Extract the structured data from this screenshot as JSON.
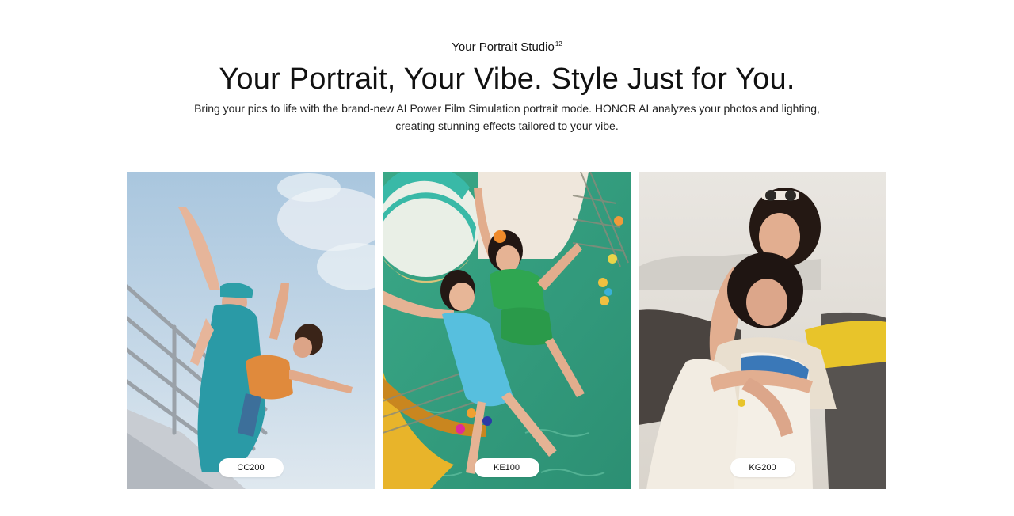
{
  "header": {
    "eyebrow": "Your Portrait Studio",
    "eyebrow_sup": "12",
    "headline": "Your Portrait, Your Vibe. Style Just for You.",
    "description": "Bring your pics to life with the brand-new AI Power Film Simulation portrait mode. HONOR AI analyzes your photos and lighting, creating stunning effects tailored to your vibe."
  },
  "cards": [
    {
      "label": "CC200",
      "scene": "two-women-railing-sky-photo"
    },
    {
      "label": "KE100",
      "scene": "two-women-pool-beach-ball-photo"
    },
    {
      "label": "KG200",
      "scene": "two-women-hugging-convertible-photo"
    }
  ]
}
